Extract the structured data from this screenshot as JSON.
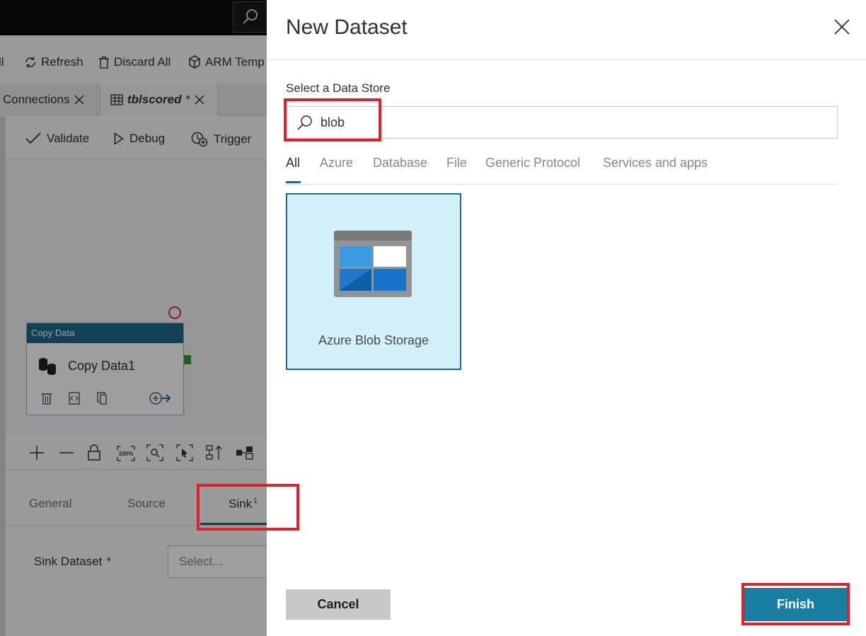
{
  "background_app": {
    "toolbar": {
      "partial_all": "ll",
      "refresh": "Refresh",
      "discard_all": "Discard All",
      "arm_template": "ARM Temp"
    },
    "doc_tabs": {
      "connections": "Connections",
      "tblscored": "tblscored",
      "tblscored_modified": "*"
    },
    "pipeline_toolbar": {
      "validate": "Validate",
      "debug": "Debug",
      "trigger": "Trigger"
    },
    "activity": {
      "type": "Copy Data",
      "name": "Copy Data1"
    },
    "zoom_controls": {
      "zoom_100": "100%"
    },
    "property_tabs": {
      "general": "General",
      "source": "Source",
      "sink": "Sink",
      "sink_error_count": "1"
    },
    "sink_dataset": {
      "label": "Sink Dataset",
      "required_mark": "*",
      "select_placeholder": "Select..."
    }
  },
  "panel": {
    "title": "New Dataset",
    "data_store_label": "Select a Data Store",
    "search": {
      "value": "blob"
    },
    "categories": [
      "All",
      "Azure",
      "Database",
      "File",
      "Generic Protocol",
      "Services and apps"
    ],
    "active_category": "All",
    "tiles": [
      {
        "label": "Azure Blob Storage",
        "icon": "azure-blob-storage-icon"
      }
    ],
    "cancel_label": "Cancel",
    "finish_label": "Finish"
  },
  "colors": {
    "accent": "#1e6a8d",
    "finish_button": "#1a7ea3",
    "tile_bg": "#d2f1fa",
    "highlight": "#e0202a",
    "error": "#c50f1f"
  }
}
